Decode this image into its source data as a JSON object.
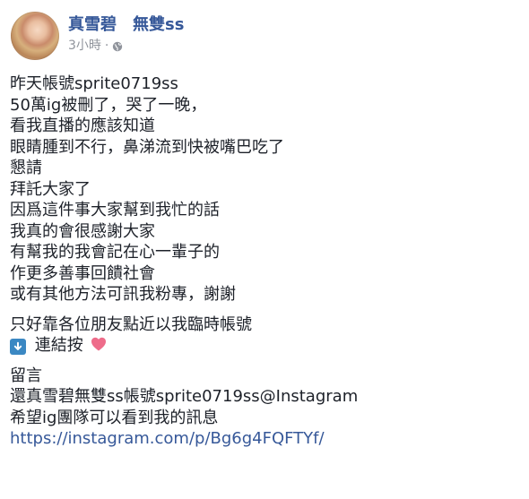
{
  "post": {
    "author": {
      "name_primary": "真雪碧",
      "name_secondary": "無雙ss"
    },
    "timestamp": "3小時",
    "separator": "·",
    "privacy_icon": "globe-icon"
  },
  "body": {
    "paragraph1": [
      "昨天帳號sprite0719ss",
      "50萬ig被刪了，哭了一晚，",
      "看我直播的應該知道",
      "眼睛腫到不行，鼻涕流到快被嘴巴吃了",
      "懇請",
      "拜託大家了",
      "因爲這件事大家幫到我忙的話",
      "我真的會很感謝大家",
      "有幫我的我會記在心一輩子的",
      "作更多善事回饋社會",
      "或有其他方法可訊我粉專，謝謝"
    ],
    "paragraph2_line1": "只好靠各位朋友點近以我臨時帳號",
    "paragraph2_line2": "連結按",
    "paragraph2_icons": {
      "before": "down-arrow-icon",
      "after": "heart-icon"
    },
    "paragraph3": [
      "留言",
      "還真雪碧無雙ss帳號sprite0719ss@Instagram",
      "希望ig團隊可以看到我的訊息"
    ],
    "link": "https://instagram.com/p/Bg6g4FQFTYf/"
  },
  "colors": {
    "link": "#365899",
    "text": "#1d2129",
    "meta": "#90949c",
    "badge": "#3b88c3",
    "heart": "#ee6c8a"
  }
}
